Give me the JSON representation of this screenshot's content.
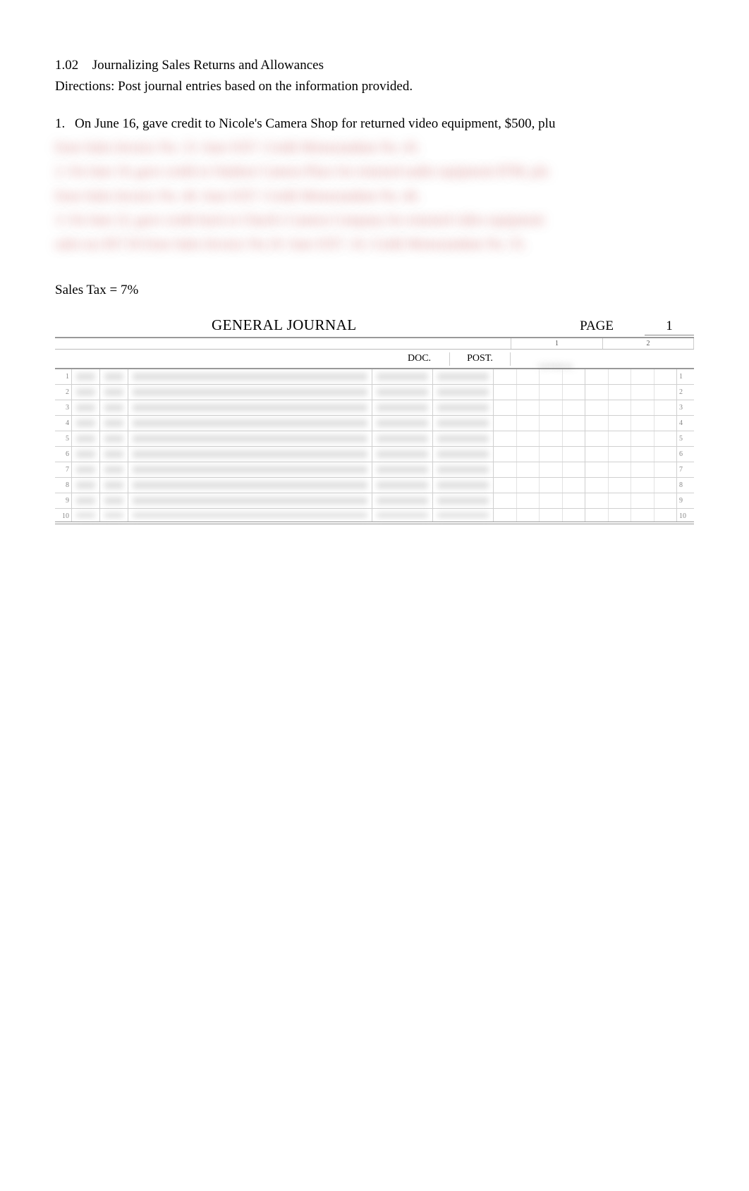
{
  "header": {
    "section_number": "1.02",
    "section_title": "Journalizing Sales Returns and Allowances",
    "directions": "Directions: Post journal entries based on the information provided."
  },
  "question1": {
    "number": "1.",
    "text": "On June 16, gave credit to Nicole's Camera Shop for returned video equipment, $500, plu"
  },
  "blurred_lines": [
    "from Sales Invoice No. 15.     Sam S357.   Credit Memorandum No. 45.",
    "2.  On June 19, gave credit to Outdoor Camera Place for returned audio equipment $700, plu",
    "from Sales Invoice No. 46.  Sam S357.  Credit Memorandum No. 46.",
    "3.  On June 22, gave credit back to Chuck's Camera Company for returned video equipment",
    "sales tax $57.50 from Sales Invoice No.19.  Sam S357. 16.  Credit Memorandum No. 55."
  ],
  "sales_tax_label": "Sales Tax = 7%",
  "journal": {
    "title": "GENERAL JOURNAL",
    "page_label": "PAGE",
    "page_number": "1",
    "money_col_numbers": [
      "1",
      "2"
    ],
    "col_doc": "DOC.",
    "col_post": "POST.",
    "rows": [
      1,
      2,
      3,
      4,
      5,
      6,
      7,
      8,
      9,
      10
    ]
  }
}
